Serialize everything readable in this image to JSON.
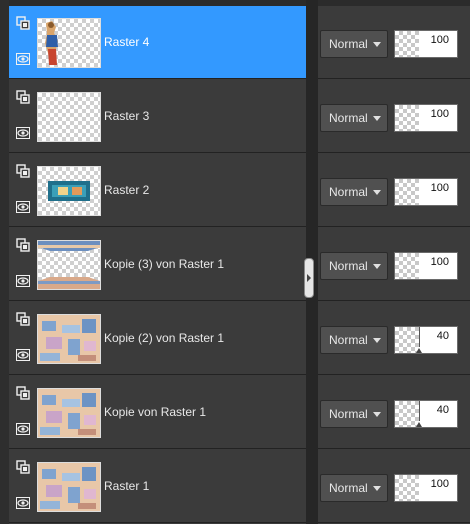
{
  "layers": [
    {
      "name": "Raster 4",
      "selected": true,
      "blend": "Normal",
      "opacity": 100,
      "thumb": "figure"
    },
    {
      "name": "Raster 3",
      "selected": false,
      "blend": "Normal",
      "opacity": 100,
      "thumb": "empty"
    },
    {
      "name": "Raster 2",
      "selected": false,
      "blend": "Normal",
      "opacity": 100,
      "thumb": "banner"
    },
    {
      "name": "Kopie (3) von Raster 1",
      "selected": false,
      "blend": "Normal",
      "opacity": 100,
      "thumb": "edges"
    },
    {
      "name": "Kopie (2) von Raster 1",
      "selected": false,
      "blend": "Normal",
      "opacity": 40,
      "thumb": "texture"
    },
    {
      "name": "Kopie von Raster 1",
      "selected": false,
      "blend": "Normal",
      "opacity": 40,
      "thumb": "texture"
    },
    {
      "name": "Raster 1",
      "selected": false,
      "blend": "Normal",
      "opacity": 100,
      "thumb": "texture"
    }
  ],
  "icons": {
    "group": "layer-group-icon",
    "visibility": "eye-icon"
  },
  "colors": {
    "selected": "#3399ff",
    "panel": "#3b3b3b"
  }
}
